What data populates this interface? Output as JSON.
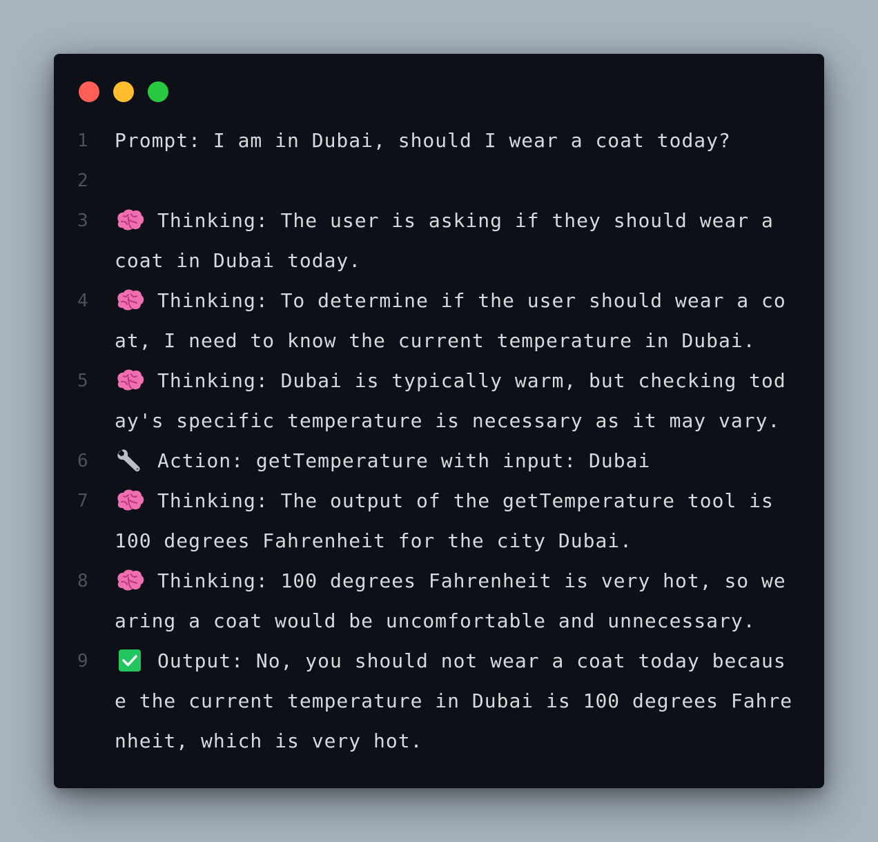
{
  "window": {
    "traffic_lights": {
      "close_color": "#ff5f57",
      "minimize_color": "#febc2e",
      "maximize_color": "#28c840"
    }
  },
  "lines": [
    {
      "number": "1",
      "icon": "",
      "text": "Prompt: I am in Dubai, should I wear a coat today?"
    },
    {
      "number": "2",
      "icon": "",
      "text": ""
    },
    {
      "number": "3",
      "icon": "brain-icon",
      "text": "Thinking: The user is asking if they should wear a coat in Dubai today."
    },
    {
      "number": "4",
      "icon": "brain-icon",
      "text": "Thinking: To determine if the user should wear a coat, I need to know the current temperature in Dubai."
    },
    {
      "number": "5",
      "icon": "brain-icon",
      "text": "Thinking: Dubai is typically warm, but checking today's specific temperature is necessary as it may vary."
    },
    {
      "number": "6",
      "icon": "wrench-icon",
      "text": "Action: getTemperature with input: Dubai"
    },
    {
      "number": "7",
      "icon": "brain-icon",
      "text": "Thinking: The output of the getTemperature tool is 100 degrees Fahrenheit for the city Dubai."
    },
    {
      "number": "8",
      "icon": "brain-icon",
      "text": "Thinking: 100 degrees Fahrenheit is very hot, so wearing a coat would be uncomfortable and unnecessary."
    },
    {
      "number": "9",
      "icon": "checkmark-icon",
      "text": "Output: No, you should not wear a coat today because the current temperature in Dubai is 100 degrees Fahrenheit, which is very hot."
    }
  ],
  "colors": {
    "window_bg": "#0d1017",
    "text": "#d6d9dd",
    "line_number": "#4b525c",
    "brain": "#f06fb0",
    "check_bg": "#22c55e"
  }
}
